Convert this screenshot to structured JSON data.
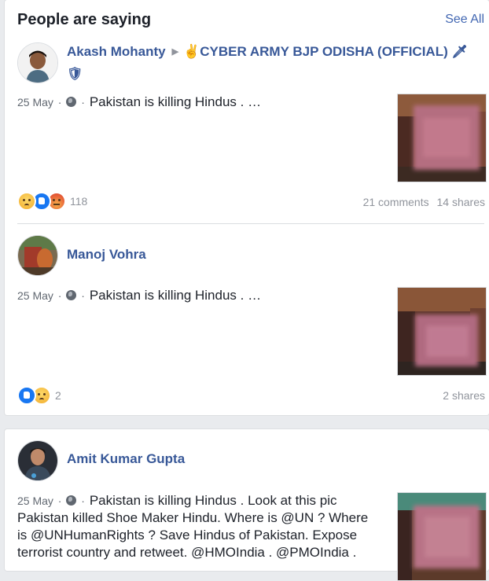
{
  "header": {
    "title": "People are saying",
    "see_all": "See All"
  },
  "posts": [
    {
      "author": "Akash Mohanty",
      "group": "✌CYBER ARMY BJP ODISHA (OFFICIAL)",
      "group_emojis": [
        "🗡",
        "🛡"
      ],
      "date": "25 May",
      "privacy_icon": "globe-icon",
      "text": "Pakistan is killing Hindus . …",
      "reactions": [
        "sad",
        "like",
        "angry"
      ],
      "reaction_count": "118",
      "comments": "21 comments",
      "shares": "14 shares"
    },
    {
      "author": "Manoj Vohra",
      "date": "25 May",
      "privacy_icon": "globe-icon",
      "text": "Pakistan is killing Hindus . …",
      "reactions": [
        "like",
        "sad"
      ],
      "reaction_count": "2",
      "shares": "2 shares"
    },
    {
      "author": "Amit Kumar Gupta",
      "date": "25 May",
      "privacy_icon": "globe-icon",
      "text": "Pakistan is killing Hindus . Look at this pic Pakistan killed Shoe Maker Hindu. Where is @UN ? Where is @UNHumanRights ? Save Hindus of Pakistan. Expose terrorist country and retweet. @HMOIndia . @PMOIndia ."
    }
  ],
  "colors": {
    "link": "#385898",
    "see_all": "#4267b2",
    "muted": "#90949c",
    "background": "#e9ebee"
  }
}
